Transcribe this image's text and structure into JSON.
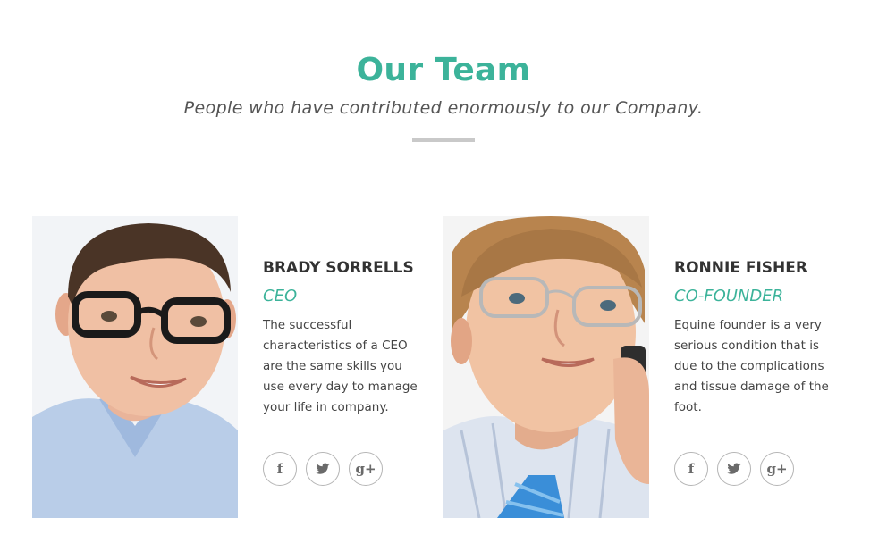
{
  "header": {
    "title": "Our Team",
    "subtitle": "People who have contributed enormously to our Company."
  },
  "members": [
    {
      "name": "BRADY SORRELLS",
      "role": "CEO",
      "bio": "The successful characteristics of a CEO are the same skills you use every day to manage your life in company.",
      "social": [
        "facebook-icon",
        "twitter-icon",
        "google-plus-icon"
      ]
    },
    {
      "name": "RONNIE FISHER",
      "role": "CO-FOUNDER",
      "bio": "Equine founder is a very serious condition that is due to the complications and tissue damage of the foot.",
      "social": [
        "facebook-icon",
        "twitter-icon",
        "google-plus-icon"
      ]
    }
  ],
  "icons": {
    "facebook": "f",
    "twitter": "bird",
    "google_plus": "g+"
  },
  "colors": {
    "accent": "#3cb39a",
    "heading": "#333333",
    "body_text": "#444444",
    "divider": "#c9c9c9",
    "icon_border": "#b5b5b5"
  }
}
